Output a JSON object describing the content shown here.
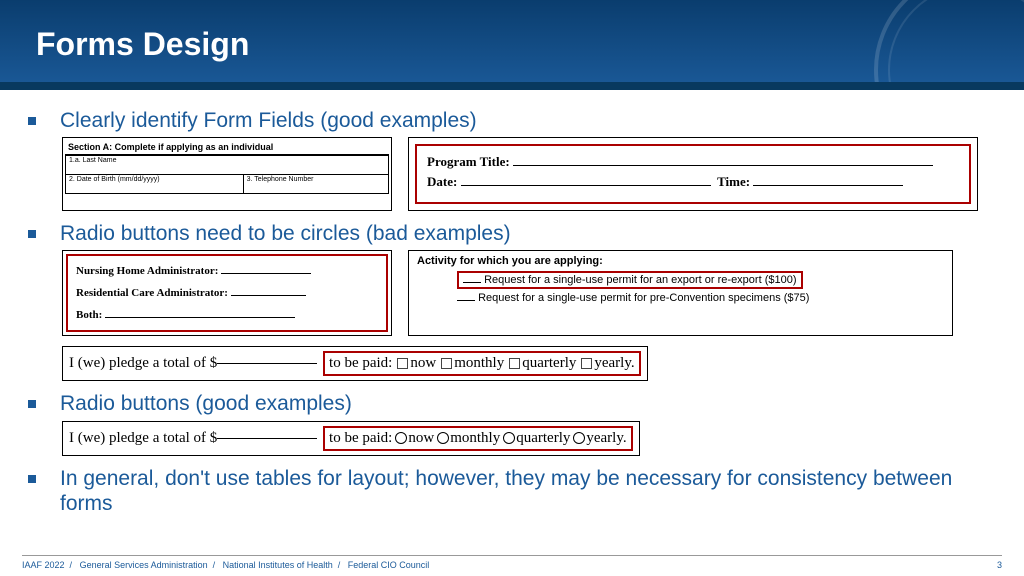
{
  "header": {
    "title": "Forms Design"
  },
  "bullets": {
    "b1": "Clearly identify Form Fields (good examples)",
    "b2": "Radio buttons need to be circles (bad examples)",
    "b3": "Radio buttons (good examples)",
    "b4": "In general, don't use tables for layout; however, they may be necessary for consistency between forms"
  },
  "sectionA": {
    "title": "Section A: Complete if applying as an individual",
    "f1": "1.a. Last Name",
    "f2": "2. Date of Birth (mm/dd/yyyy)",
    "f3": "3. Telephone Number"
  },
  "prog": {
    "p1": "Program Title:",
    "p2a": "Date:",
    "p2b": "Time:"
  },
  "nurse": {
    "l1": "Nursing Home Administrator:",
    "l2": "Residential Care Administrator:",
    "l3": "Both:"
  },
  "activity": {
    "title": "Activity for which you are applying:",
    "o1": "Request for a single-use permit for an export or re-export ($100)",
    "o2": "Request for a single-use permit for pre-Convention specimens ($75)"
  },
  "pledge": {
    "pre": "I (we) pledge a total of $",
    "mid": "to be paid:",
    "now": "now",
    "monthly": "monthly",
    "quarterly": "quarterly",
    "yearly": "yearly."
  },
  "footer": {
    "a": "IAAF 2022",
    "b": "General Services Administration",
    "c": "National Institutes of Health",
    "d": "Federal CIO Council",
    "page": "3"
  }
}
